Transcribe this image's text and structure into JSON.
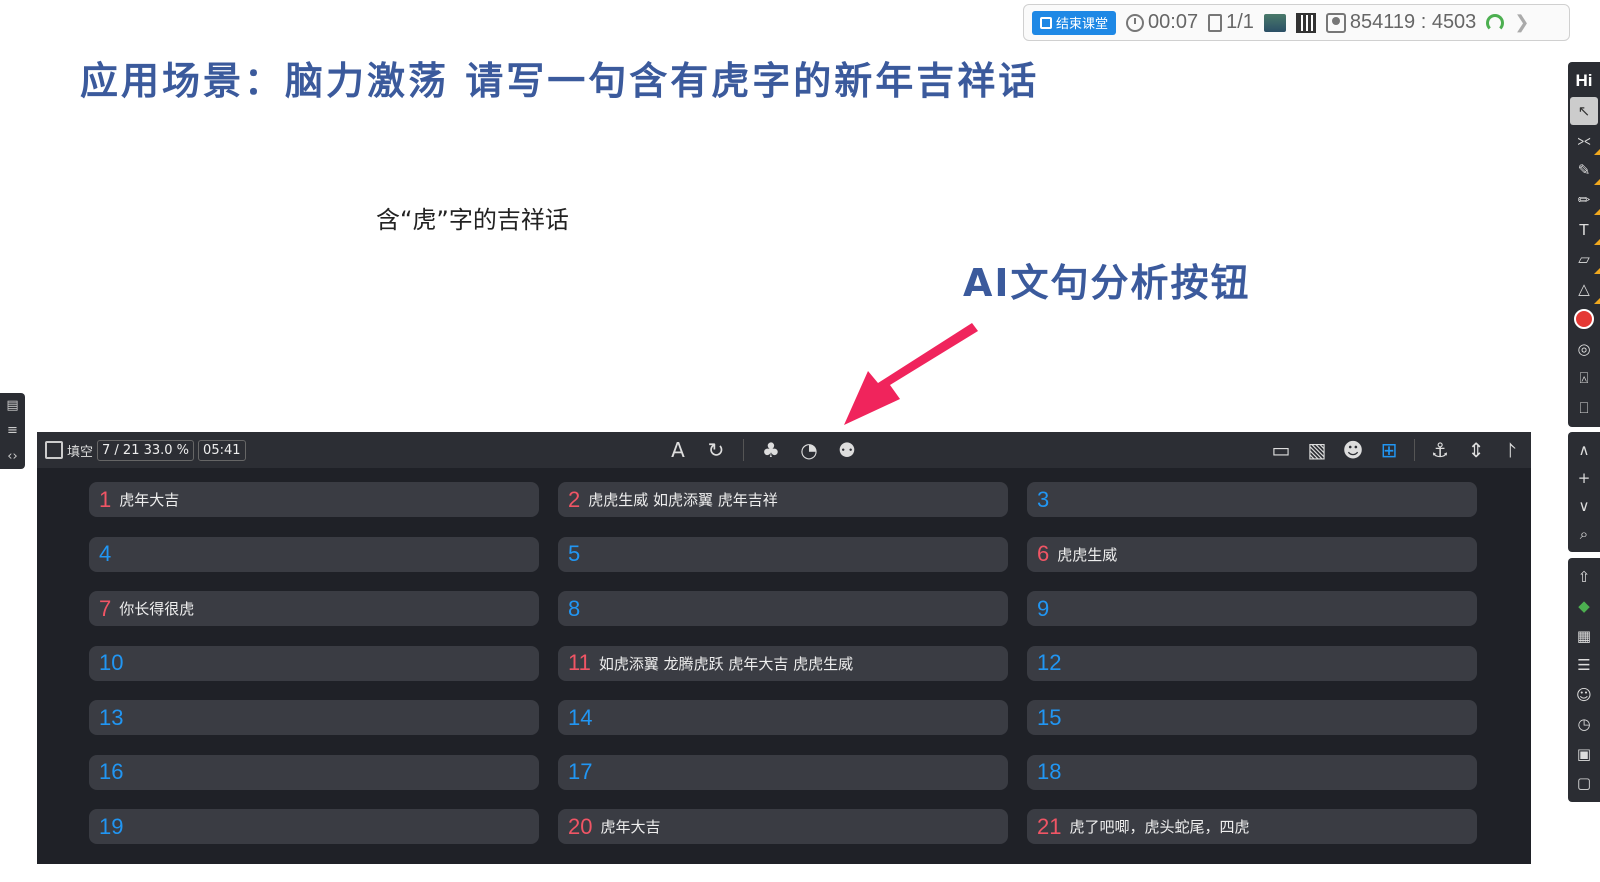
{
  "status_bar": {
    "end_class_label": "结束课堂",
    "timer": "00:07",
    "page": "1/1",
    "room_code": "854119 : 4503"
  },
  "slide": {
    "title": "应用场景：脑力激荡  请写一句含有虎字的新年吉祥话",
    "subtitle": "含“虎”字的吉祥话",
    "annotation": "AI文句分析按钮"
  },
  "panel": {
    "mode_label": "填空",
    "progress": "7 / 21  33.0 %",
    "time": "05:41",
    "cells": [
      {
        "num": "1",
        "text": "虎年大吉",
        "filled": true
      },
      {
        "num": "2",
        "text": "虎虎生威 如虎添翼 虎年吉祥",
        "filled": true
      },
      {
        "num": "3",
        "text": "",
        "filled": false
      },
      {
        "num": "4",
        "text": "",
        "filled": false
      },
      {
        "num": "5",
        "text": "",
        "filled": false
      },
      {
        "num": "6",
        "text": "虎虎生威",
        "filled": true
      },
      {
        "num": "7",
        "text": "你长得很虎",
        "filled": true
      },
      {
        "num": "8",
        "text": "",
        "filled": false
      },
      {
        "num": "9",
        "text": "",
        "filled": false
      },
      {
        "num": "10",
        "text": "",
        "filled": false
      },
      {
        "num": "11",
        "text": "如虎添翼 龙腾虎跃 虎年大吉 虎虎生威",
        "filled": true
      },
      {
        "num": "12",
        "text": "",
        "filled": false
      },
      {
        "num": "13",
        "text": "",
        "filled": false
      },
      {
        "num": "14",
        "text": "",
        "filled": false
      },
      {
        "num": "15",
        "text": "",
        "filled": false
      },
      {
        "num": "16",
        "text": "",
        "filled": false
      },
      {
        "num": "17",
        "text": "",
        "filled": false
      },
      {
        "num": "18",
        "text": "",
        "filled": false
      },
      {
        "num": "19",
        "text": "",
        "filled": false
      },
      {
        "num": "20",
        "text": "虎年大吉",
        "filled": true
      },
      {
        "num": "21",
        "text": "虎了吧唧，虎头蛇尾，四虎",
        "filled": true
      }
    ]
  },
  "right_toolbar_top_label": "Hi",
  "colors": {
    "title": "#3b5a9c",
    "panel_bg": "#1f2127",
    "cell_bg": "#3a3c43",
    "empty_num": "#2196f3",
    "filled_num": "#f05565",
    "arrow": "#f0245c"
  }
}
